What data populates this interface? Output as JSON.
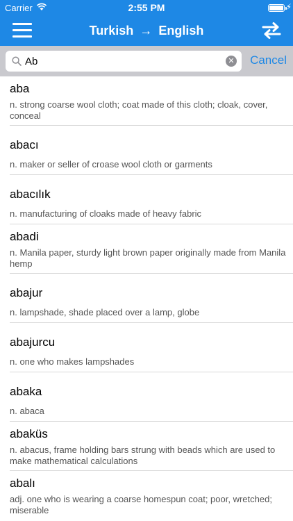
{
  "status_bar": {
    "carrier": "Carrier",
    "time": "2:55 PM",
    "battery_level": 1.0
  },
  "nav": {
    "title_from": "Turkish",
    "arrow": "→",
    "title_to": "English"
  },
  "search": {
    "value": "Ab",
    "placeholder": "",
    "cancel_label": "Cancel"
  },
  "icons": {
    "menu": "hamburger-menu-icon",
    "swap": "swap-arrows-icon",
    "search": "magnifier-icon",
    "clear": "clear-x-icon",
    "wifi": "wifi-icon",
    "battery": "battery-icon",
    "charging": "charging-bolt-icon"
  },
  "colors": {
    "accent": "#1e88e5",
    "search_bar_bg": "#c9c9ce",
    "definition_text": "#555555"
  },
  "entries": [
    {
      "term": "aba",
      "definition": "n. strong coarse wool cloth; coat made of this cloth; cloak, cover, conceal"
    },
    {
      "term": "abacı",
      "definition": "n. maker or seller of croase wool cloth or garments"
    },
    {
      "term": "abacılık",
      "definition": "n. manufacturing of cloaks made of heavy fabric"
    },
    {
      "term": "abadi",
      "definition": "n. Manila paper, sturdy light brown paper originally made from Manila hemp"
    },
    {
      "term": "abajur",
      "definition": "n. lampshade, shade placed over a lamp, globe"
    },
    {
      "term": "abajurcu",
      "definition": "n. one who makes lampshades"
    },
    {
      "term": "abaka",
      "definition": "n. abaca"
    },
    {
      "term": "abaküs",
      "definition": "n. abacus, frame holding bars strung with beads which are used to make mathematical calculations"
    },
    {
      "term": "abalı",
      "definition": "adj. one who is wearing a coarse homespun coat; poor, wretched; miserable"
    }
  ]
}
